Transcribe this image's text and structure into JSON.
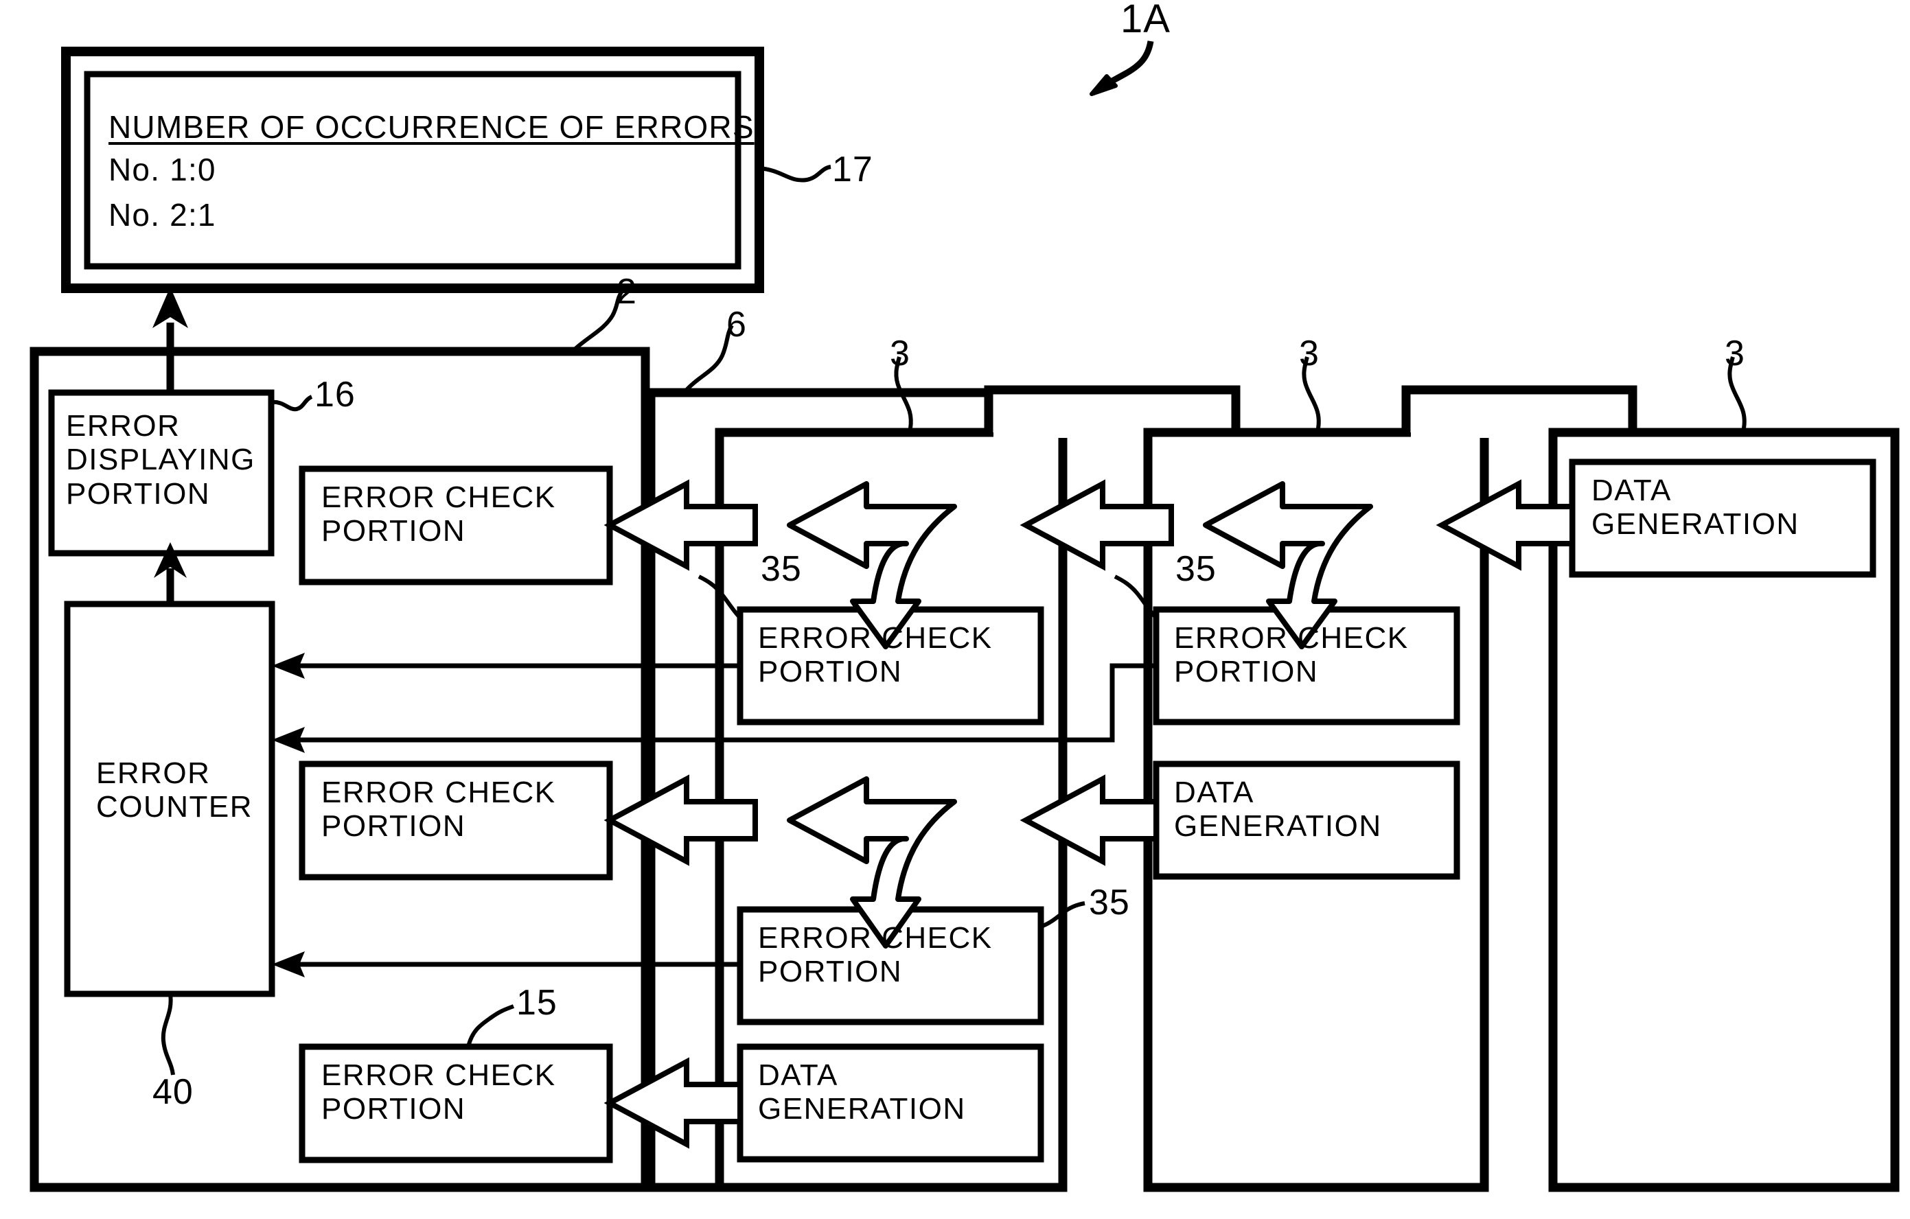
{
  "figure": {
    "system_ref": "1A"
  },
  "display_panel": {
    "ref": "17",
    "title": "NUMBER OF OCCURRENCE OF ERRORS",
    "lines": [
      "No. 1:0",
      "No. 2:1"
    ]
  },
  "panels": [
    {
      "id": "panel-2",
      "ref": "2"
    },
    {
      "id": "panel-6",
      "ref": "6"
    },
    {
      "id": "panel-3a",
      "ref": "3"
    },
    {
      "id": "panel-3b",
      "ref": "3"
    },
    {
      "id": "panel-3c",
      "ref": "3"
    }
  ],
  "blocks": {
    "error_displaying_portion": {
      "ref": "16",
      "label": "ERROR\nDISPLAYING\nPORTION"
    },
    "error_counter": {
      "ref": "40",
      "label": "ERROR\nCOUNTER"
    },
    "error_check_top": {
      "label": "ERROR CHECK\nPORTION"
    },
    "error_check_mid": {
      "label": "ERROR CHECK\nPORTION"
    },
    "error_check_bottom": {
      "ref": "15",
      "label": "ERROR CHECK\nPORTION"
    },
    "error_check_p6_upper": {
      "ref": "35",
      "label": "ERROR CHECK\nPORTION"
    },
    "error_check_p6_lower": {
      "ref": "35",
      "label": "ERROR CHECK\nPORTION"
    },
    "error_check_p3a": {
      "ref": "35",
      "label": "ERROR CHECK\nPORTION"
    },
    "data_generation_p3a": {
      "label": "DATA\nGENERATION"
    },
    "data_generation_p3c": {
      "label": "DATA\nGENERATION"
    },
    "data_generation_p6": {
      "label": "DATA\nGENERATION"
    }
  },
  "refs": {
    "r1A": "1A",
    "r17": "17",
    "r16": "16",
    "r40": "40",
    "r15": "15",
    "r2": "2",
    "r6": "6",
    "r3a": "3",
    "r3b": "3",
    "r3c": "3",
    "r35a": "35",
    "r35b": "35",
    "r35c": "35"
  },
  "colors": {
    "ink": "#000000",
    "paper": "#ffffff"
  }
}
